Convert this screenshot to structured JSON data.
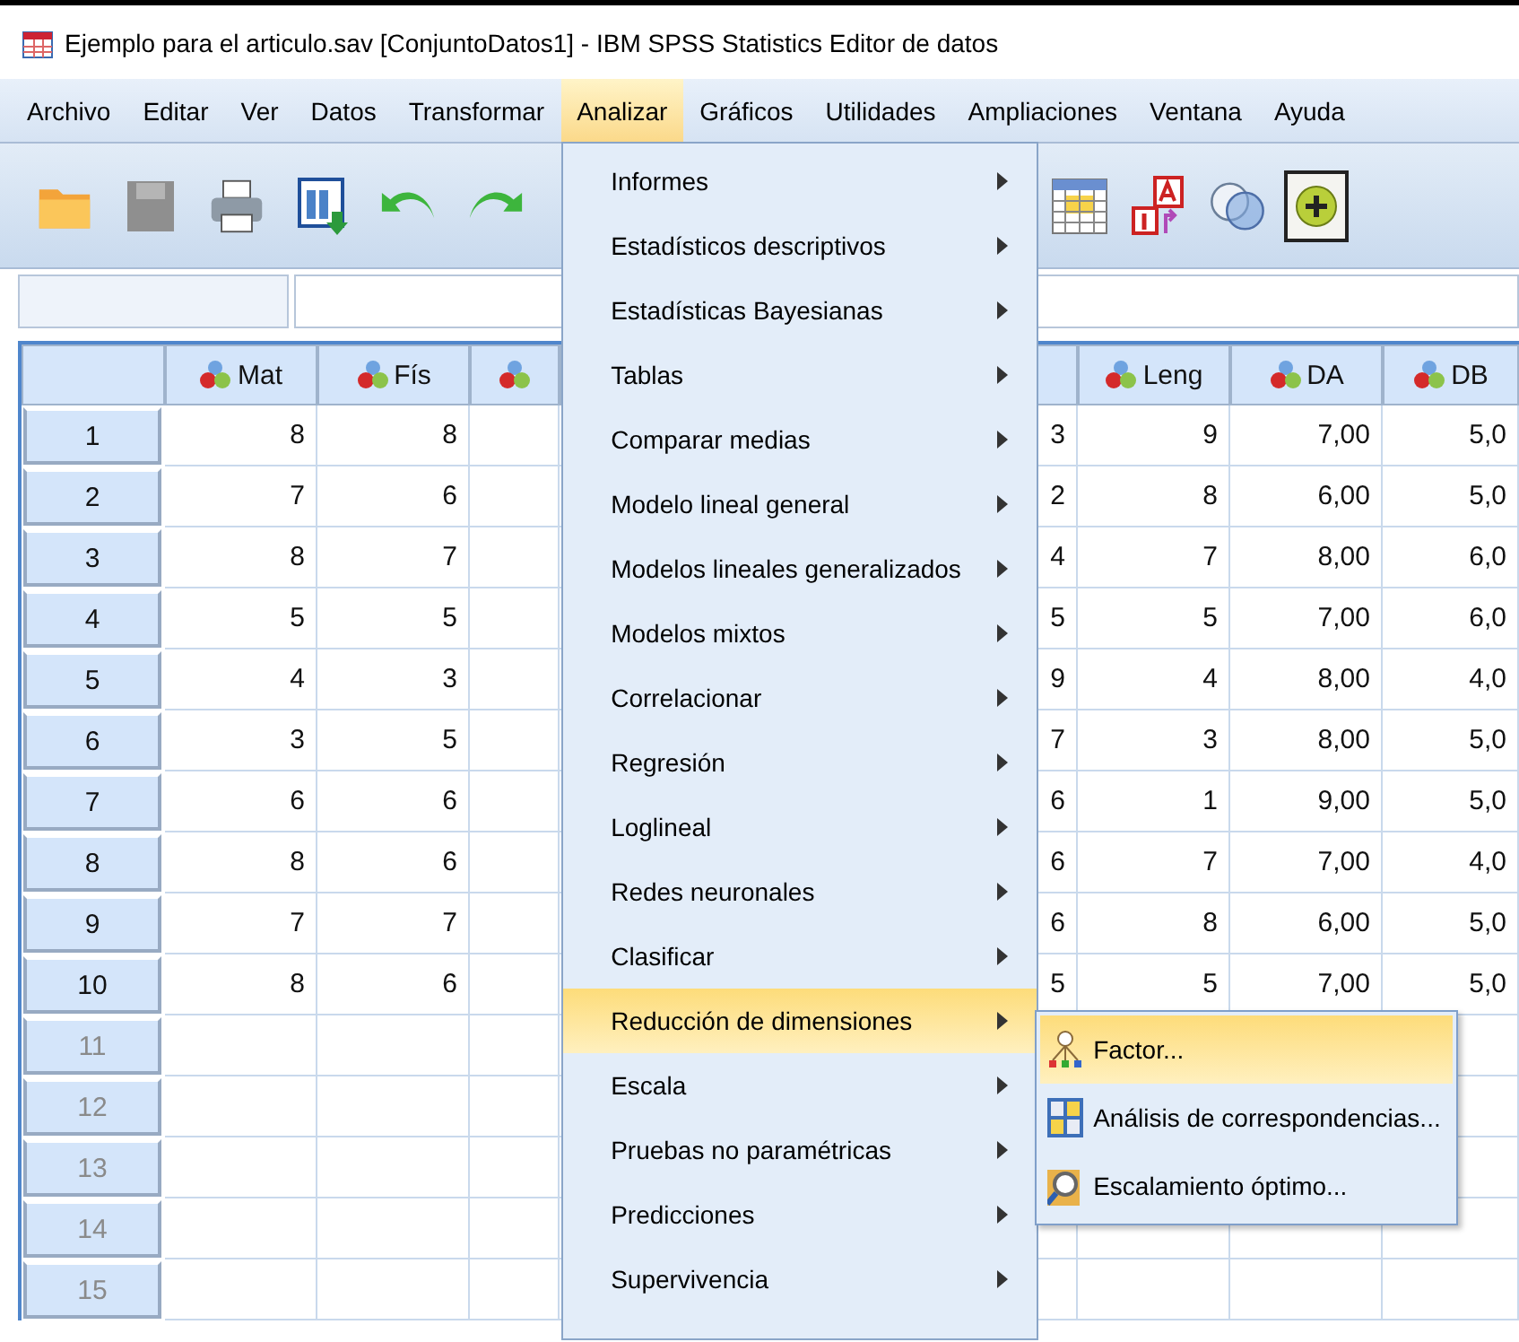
{
  "window": {
    "title": "Ejemplo para el articulo.sav [ConjuntoDatos1] - IBM SPSS Statistics Editor de datos"
  },
  "menu_bar": [
    {
      "label": "Archivo",
      "selected": false
    },
    {
      "label": "Editar",
      "selected": false
    },
    {
      "label": "Ver",
      "selected": false
    },
    {
      "label": "Datos",
      "selected": false
    },
    {
      "label": "Transformar",
      "selected": false
    },
    {
      "label": "Analizar",
      "selected": true
    },
    {
      "label": "Gráficos",
      "selected": false
    },
    {
      "label": "Utilidades",
      "selected": false
    },
    {
      "label": "Ampliaciones",
      "selected": false
    },
    {
      "label": "Ventana",
      "selected": false
    },
    {
      "label": "Ayuda",
      "selected": false
    }
  ],
  "toolbar": {
    "left": [
      {
        "kind": "open"
      },
      {
        "kind": "save",
        "disabled": true
      },
      {
        "kind": "print"
      },
      {
        "kind": "import"
      },
      {
        "kind": "undo"
      },
      {
        "kind": "redo"
      }
    ],
    "right": [
      {
        "kind": "table"
      },
      {
        "kind": "labels"
      },
      {
        "kind": "sets"
      },
      {
        "kind": "add",
        "selected": true
      }
    ]
  },
  "analizar_menu": [
    {
      "label": "Informes",
      "selected": false
    },
    {
      "label": "Estadísticos descriptivos",
      "selected": false
    },
    {
      "label": "Estadísticas Bayesianas",
      "selected": false
    },
    {
      "label": "Tablas",
      "selected": false
    },
    {
      "label": "Comparar medias",
      "selected": false
    },
    {
      "label": "Modelo lineal general",
      "selected": false
    },
    {
      "label": "Modelos lineales generalizados",
      "selected": false
    },
    {
      "label": "Modelos mixtos",
      "selected": false
    },
    {
      "label": "Correlacionar",
      "selected": false
    },
    {
      "label": "Regresión",
      "selected": false
    },
    {
      "label": "Loglineal",
      "selected": false
    },
    {
      "label": "Redes neuronales",
      "selected": false
    },
    {
      "label": "Clasificar",
      "selected": false
    },
    {
      "label": "Reducción de dimensiones",
      "selected": true,
      "submenu": [
        {
          "kind": "factor",
          "label": "Factor...",
          "selected": true
        },
        {
          "kind": "correspondence",
          "label": "Análisis de correspondencias...",
          "selected": false
        },
        {
          "kind": "scaling",
          "label": "Escalamiento óptimo...",
          "selected": false
        }
      ]
    },
    {
      "label": "Escala",
      "selected": false
    },
    {
      "label": "Pruebas no paramétricas",
      "selected": false
    },
    {
      "label": "Predicciones",
      "selected": false
    },
    {
      "label": "Supervivencia",
      "selected": false
    }
  ],
  "grid": {
    "columns": [
      {
        "kind": "variable",
        "label": "Mat"
      },
      {
        "kind": "variable",
        "label": "Fís"
      },
      {
        "kind": "variable"
      },
      {
        "kind": "covered"
      },
      {
        "kind": "blank"
      },
      {
        "kind": "variable",
        "label": "Leng"
      },
      {
        "kind": "variable",
        "label": "DA"
      },
      {
        "kind": "variable",
        "label": "DB"
      }
    ],
    "rows": [
      {
        "number": "1",
        "cells": [
          "8",
          "8",
          null,
          null,
          "3",
          "9",
          "7,00",
          "5,0"
        ]
      },
      {
        "number": "2",
        "cells": [
          "7",
          "6",
          null,
          null,
          "2",
          "8",
          "6,00",
          "5,0"
        ]
      },
      {
        "number": "3",
        "cells": [
          "8",
          "7",
          null,
          null,
          "4",
          "7",
          "8,00",
          "6,0"
        ]
      },
      {
        "number": "4",
        "cells": [
          "5",
          "5",
          null,
          null,
          "5",
          "5",
          "7,00",
          "6,0"
        ]
      },
      {
        "number": "5",
        "cells": [
          "4",
          "3",
          null,
          null,
          "9",
          "4",
          "8,00",
          "4,0"
        ]
      },
      {
        "number": "6",
        "cells": [
          "3",
          "5",
          null,
          null,
          "7",
          "3",
          "8,00",
          "5,0"
        ]
      },
      {
        "number": "7",
        "cells": [
          "6",
          "6",
          null,
          null,
          "6",
          "1",
          "9,00",
          "5,0"
        ]
      },
      {
        "number": "8",
        "cells": [
          "8",
          "6",
          null,
          null,
          "6",
          "7",
          "7,00",
          "4,0"
        ]
      },
      {
        "number": "9",
        "cells": [
          "7",
          "7",
          null,
          null,
          "6",
          "8",
          "6,00",
          "5,0"
        ]
      },
      {
        "number": "10",
        "cells": [
          "8",
          "6",
          null,
          null,
          "5",
          "5",
          "7,00",
          "5,0"
        ]
      },
      {
        "number": "11",
        "cells": []
      },
      {
        "number": "12",
        "cells": []
      },
      {
        "number": "13",
        "cells": []
      },
      {
        "number": "14",
        "cells": []
      },
      {
        "number": "15",
        "cells": []
      }
    ]
  }
}
